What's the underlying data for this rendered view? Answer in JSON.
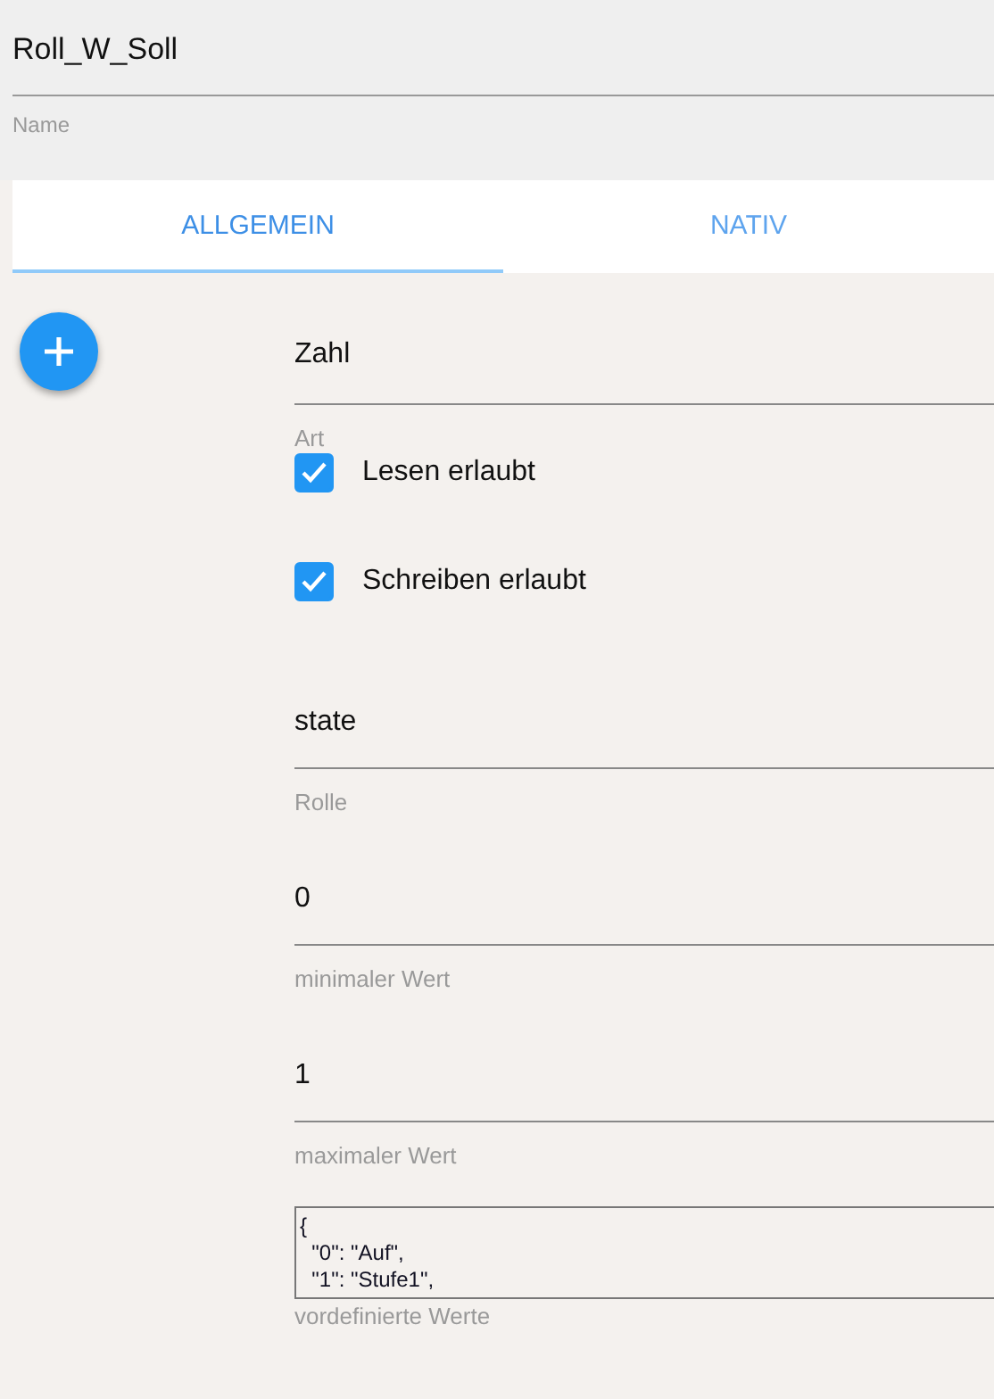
{
  "name_field": {
    "value": "Roll_W_Soll",
    "label": "Name"
  },
  "tabs": [
    {
      "label": "ALLGEMEIN",
      "selected": true
    },
    {
      "label": "NATIV",
      "selected": false
    }
  ],
  "fields": [
    {
      "kind": "select",
      "value": "Zahl",
      "label": "Art"
    },
    {
      "kind": "checkbox",
      "label": "Lesen erlaubt",
      "checked": true
    },
    {
      "kind": "checkbox",
      "label": "Schreiben erlaubt",
      "checked": true
    },
    {
      "kind": "text",
      "value": "state",
      "label": "Rolle"
    },
    {
      "kind": "text",
      "value": "0",
      "label": "minimaler Wert"
    },
    {
      "kind": "text",
      "value": "1",
      "label": "maximaler Wert"
    },
    {
      "kind": "textarea",
      "value": "{\n  \"0\": \"Auf\",\n  \"1\": \"Stufe1\",",
      "label": "vordefinierte Werte"
    }
  ]
}
